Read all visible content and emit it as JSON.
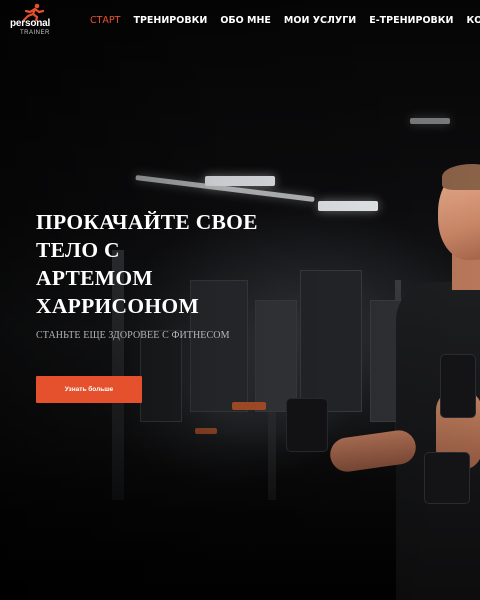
{
  "brand": {
    "logo_text": "personal",
    "logo_subtext": "TRAINER",
    "accent_color": "#e4512c"
  },
  "nav": {
    "items": [
      {
        "label": "СТАРТ",
        "active": true
      },
      {
        "label": "ТРЕНИРОВКИ",
        "active": false
      },
      {
        "label": "ОБО МНЕ",
        "active": false
      },
      {
        "label": "МОИ УСЛУГИ",
        "active": false
      },
      {
        "label": "E-ТРЕНИРОВКИ",
        "active": false
      },
      {
        "label": "КОНТАКТЫ",
        "active": false
      }
    ]
  },
  "hero": {
    "title_lines": [
      "ПРОКАЧАЙТЕ СВОЕ",
      "ТЕЛО С",
      "АРТЕМОМ",
      "ХАРРИСОНОМ"
    ],
    "subtitle": "СТАНЬТЕ ЕЩЕ ЗДОРОВЕЕ С ФИТНЕСОМ",
    "cta_label": "Узнать больше"
  }
}
